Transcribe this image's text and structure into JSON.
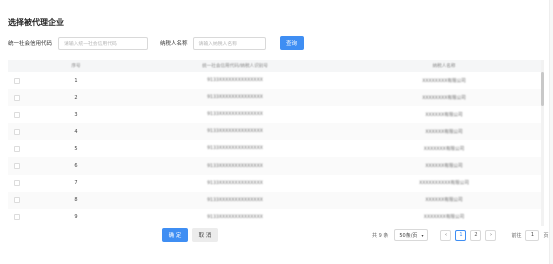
{
  "dialog": {
    "title": "选择被代理企业"
  },
  "search": {
    "credit_code_label": "统一社会信用代码",
    "credit_code_placeholder": "请输入统一社会信用代码",
    "taxpayer_name_label": "纳税人名称",
    "taxpayer_name_placeholder": "请输入纳税人名称",
    "query_label": "查询"
  },
  "table": {
    "headers": [
      "序号",
      "统一社会信用代码/纳税人识别号",
      "纳税人名称"
    ],
    "rows": [
      {
        "index": "1",
        "code": "9133XXXXXXXXXXXXXX",
        "name": "XXXXXXXX有限公司"
      },
      {
        "index": "2",
        "code": "9133XXXXXXXXXXXXXX",
        "name": "XXXXXXXX有限公司"
      },
      {
        "index": "3",
        "code": "9133XXXXXXXXXXXXXX",
        "name": "XXXXXX有限公司"
      },
      {
        "index": "4",
        "code": "9133XXXXXXXXXXXXXX",
        "name": "XXXXXX有限公司"
      },
      {
        "index": "5",
        "code": "9133XXXXXXXXXXXXXX",
        "name": "XXXXXXX有限公司"
      },
      {
        "index": "6",
        "code": "9133XXXXXXXXXXXXXX",
        "name": "XXXXXX有限公司"
      },
      {
        "index": "7",
        "code": "9133XXXXXXXXXXXXXX",
        "name": "XXXXXXXXXX有限公司"
      },
      {
        "index": "8",
        "code": "9133XXXXXXXXXXXXXX",
        "name": "XXXXXX有限公司"
      },
      {
        "index": "9",
        "code": "9133XXXXXXXXXXXXXX",
        "name": "XXXXXXX有限公司"
      }
    ]
  },
  "footer": {
    "confirm_label": "确 定",
    "cancel_label": "取 消"
  },
  "pagination": {
    "total_text": "共 9 条",
    "page_size": "50条/页",
    "pages": [
      "1",
      "2"
    ],
    "active_page": "1",
    "prev_icon": "chevron-left",
    "next_icon": "chevron-right",
    "jump_label": "前往",
    "jump_value": "1",
    "jump_suffix": "页"
  },
  "colors": {
    "primary": "#3f8ef3",
    "header_bg": "#f5f6f7",
    "border": "#d9d9d9"
  }
}
